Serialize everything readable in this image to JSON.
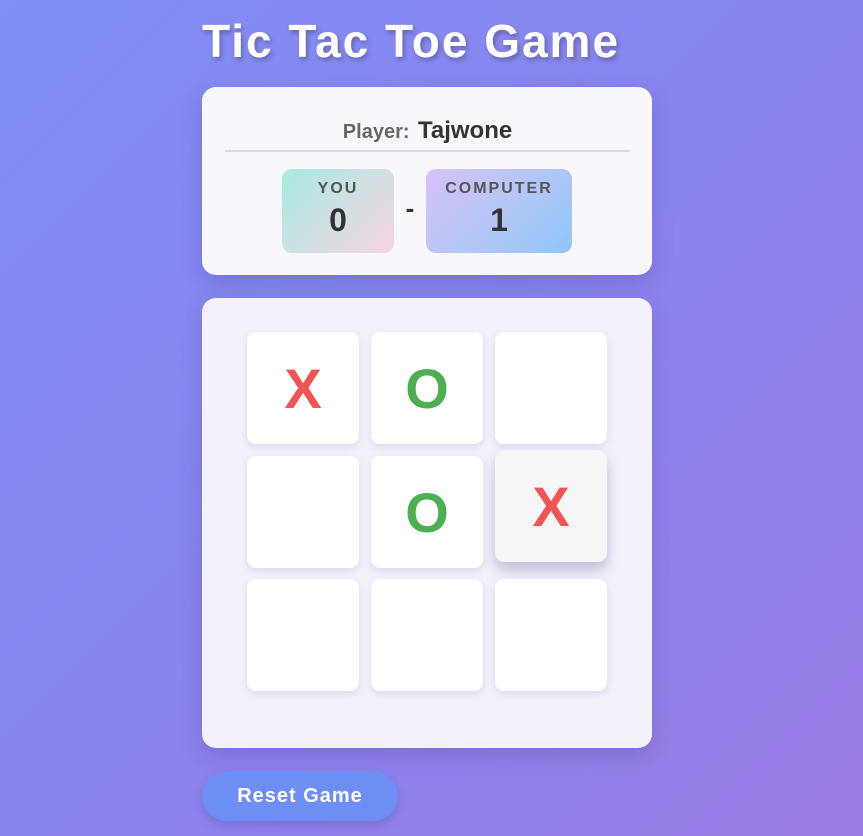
{
  "title": "Tic Tac Toe Game",
  "player": {
    "label": "Player:",
    "name": "Tajwone"
  },
  "score": {
    "you_label": "YOU",
    "you_value": "0",
    "separator": "-",
    "computer_label": "COMPUTER",
    "computer_value": "1"
  },
  "board": {
    "cells": [
      "X",
      "O",
      "",
      "",
      "O",
      "X",
      "",
      "",
      ""
    ],
    "hovered_cell": 5
  },
  "reset_label": "Reset Game",
  "colors": {
    "x": "#f05454",
    "o": "#4caf50"
  }
}
